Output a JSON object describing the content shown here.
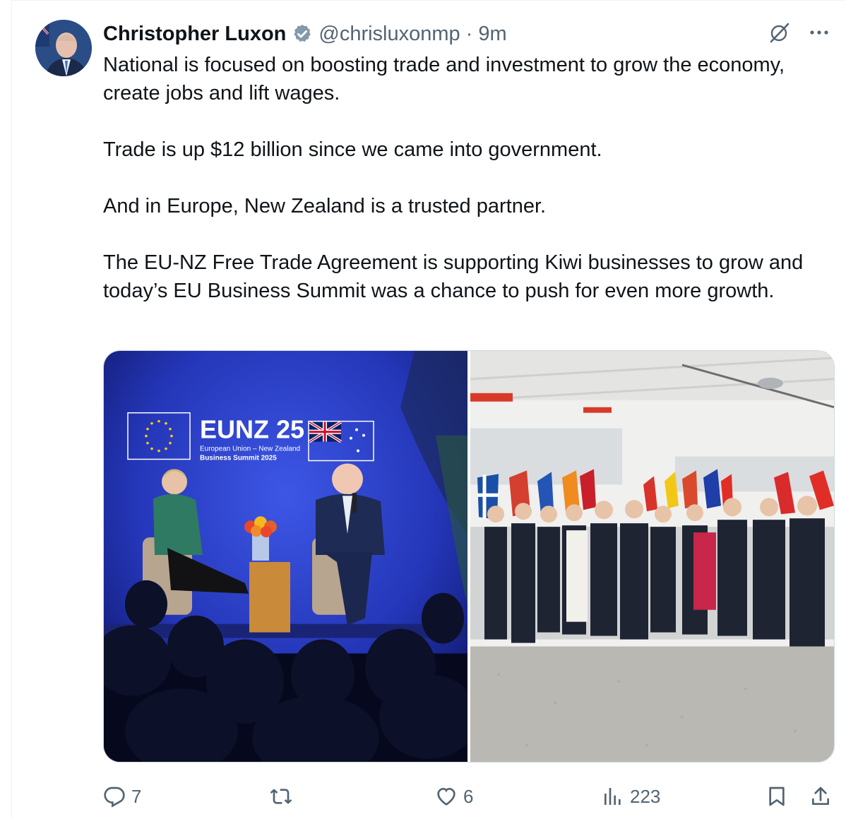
{
  "tweet": {
    "author_name": "Christopher Luxon",
    "handle": "@chrisluxonmp",
    "separator": "·",
    "time": "9m",
    "text": "National is focused on boosting trade and investment to grow the economy, create jobs and lift wages.\n\nTrade is up $12 billion since we came into government.\n\nAnd in Europe, New Zealand is a trusted partner.\n\nThe EU-NZ Free Trade Agreement is supporting Kiwi businesses to grow and today’s EU Business Summit was a chance to push for even more growth.",
    "media": {
      "left": {
        "banner_title": "EUNZ 25",
        "banner_sub1": "European Union – New Zealand",
        "banner_sub2": "Business Summit 2025"
      }
    }
  },
  "actions": {
    "reply_count": "7",
    "retweet_count": "",
    "like_count": "6",
    "view_count": "223"
  },
  "colors": {
    "accent": "#1d9bf0",
    "muted": "#536471",
    "text": "#0f1419"
  }
}
